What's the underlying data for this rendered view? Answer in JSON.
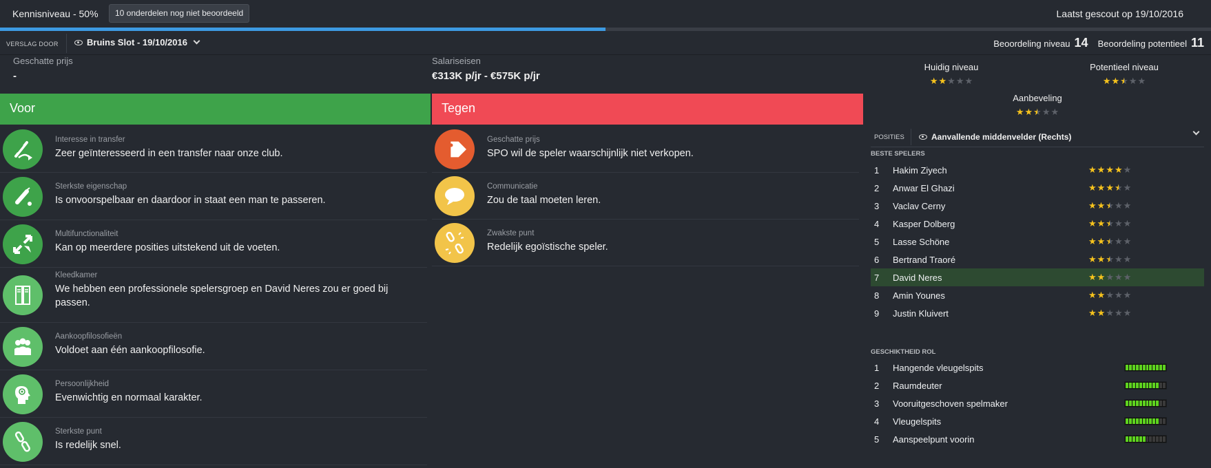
{
  "header": {
    "knowledge_label": "Kennisniveau - 50%",
    "knowledge_percent": 50,
    "unrated_button": "10 onderdelen nog niet beoordeeld",
    "last_scouted": "Laatst gescout op 19/10/2016"
  },
  "report": {
    "label": "VERSLAG DOOR",
    "scout": "Bruins Slot - 19/10/2016",
    "rating_level_label": "Beoordeling niveau",
    "rating_level": "14",
    "rating_potential_label": "Beoordeling potentieel",
    "rating_potential": "11"
  },
  "info": {
    "price_label": "Geschatte prijs",
    "price_value": "-",
    "salary_label": "Salariseisen",
    "salary_value": "€313K p/jr - €575K p/jr"
  },
  "levels": {
    "current_label": "Huidig niveau",
    "current_stars": 2,
    "potential_label": "Potentieel niveau",
    "potential_stars": 2.5,
    "recommendation_label": "Aanbeveling",
    "recommendation_stars": 2.5
  },
  "pros": {
    "title": "Voor",
    "items": [
      {
        "label": "Interesse in transfer",
        "value": "Zeer geïnteresseerd in een transfer naar onze club.",
        "icon": "transfer-icon"
      },
      {
        "label": "Sterkste eigenschap",
        "value": "Is onvoorspelbaar en daardoor in staat een man te passeren.",
        "icon": "dribble-icon"
      },
      {
        "label": "Multifunctionaliteit",
        "value": "Kan op meerdere posities uitstekend uit de voeten.",
        "icon": "versatility-icon"
      },
      {
        "label": "Kleedkamer",
        "value": "We hebben een professionele spelersgroep en David Neres zou er goed bij passen.",
        "icon": "locker-icon"
      },
      {
        "label": "Aankoopfilosofieën",
        "value": "Voldoet aan één aankoopfilosofie.",
        "icon": "group-icon"
      },
      {
        "label": "Persoonlijkheid",
        "value": "Evenwichtig en normaal karakter.",
        "icon": "head-icon"
      },
      {
        "label": "Sterkste punt",
        "value": "Is redelijk snel.",
        "icon": "link-icon"
      }
    ]
  },
  "cons": {
    "title": "Tegen",
    "items": [
      {
        "label": "Geschatte prijs",
        "value": "SPO wil de speler waarschijnlijk niet verkopen.",
        "icon": "price-tag-icon"
      },
      {
        "label": "Communicatie",
        "value": "Zou de taal moeten leren.",
        "icon": "speech-bubble-icon"
      },
      {
        "label": "Zwakste punt",
        "value": "Redelijk egoïstische speler.",
        "icon": "broken-link-icon"
      }
    ]
  },
  "positions": {
    "label": "POSITIES",
    "selected": "Aanvallende middenvelder (Rechts)",
    "best_players_title": "BESTE SPELERS",
    "players": [
      {
        "rank": "1",
        "name": "Hakim Ziyech",
        "stars": 4
      },
      {
        "rank": "2",
        "name": "Anwar El Ghazi",
        "stars": 3.5
      },
      {
        "rank": "3",
        "name": "Vaclav Cerny",
        "stars": 2.5
      },
      {
        "rank": "4",
        "name": "Kasper Dolberg",
        "stars": 2.5
      },
      {
        "rank": "5",
        "name": "Lasse Schöne",
        "stars": 2.5
      },
      {
        "rank": "6",
        "name": "Bertrand Traoré",
        "stars": 2.5
      },
      {
        "rank": "7",
        "name": "David Neres",
        "stars": 2
      },
      {
        "rank": "8",
        "name": "Amin Younes",
        "stars": 2
      },
      {
        "rank": "9",
        "name": "Justin Kluivert",
        "stars": 2
      }
    ],
    "role_title": "GESCHIKTHEID ROL",
    "roles": [
      {
        "rank": "1",
        "name": "Hangende vleugelspits",
        "fill": 1.0
      },
      {
        "rank": "2",
        "name": "Raumdeuter",
        "fill": 0.8
      },
      {
        "rank": "3",
        "name": "Vooruitgeschoven spelmaker",
        "fill": 0.8
      },
      {
        "rank": "4",
        "name": "Vleugelspits",
        "fill": 0.8
      },
      {
        "rank": "5",
        "name": "Aanspeelpunt voorin",
        "fill": 0.5
      }
    ]
  },
  "colors": {
    "accent": "#3d9ae2",
    "pro": "#3ea34a",
    "con": "#f04a55",
    "star": "#f7c31d",
    "bar": "#5ed31f",
    "highlight_row": "#2d4a31"
  }
}
